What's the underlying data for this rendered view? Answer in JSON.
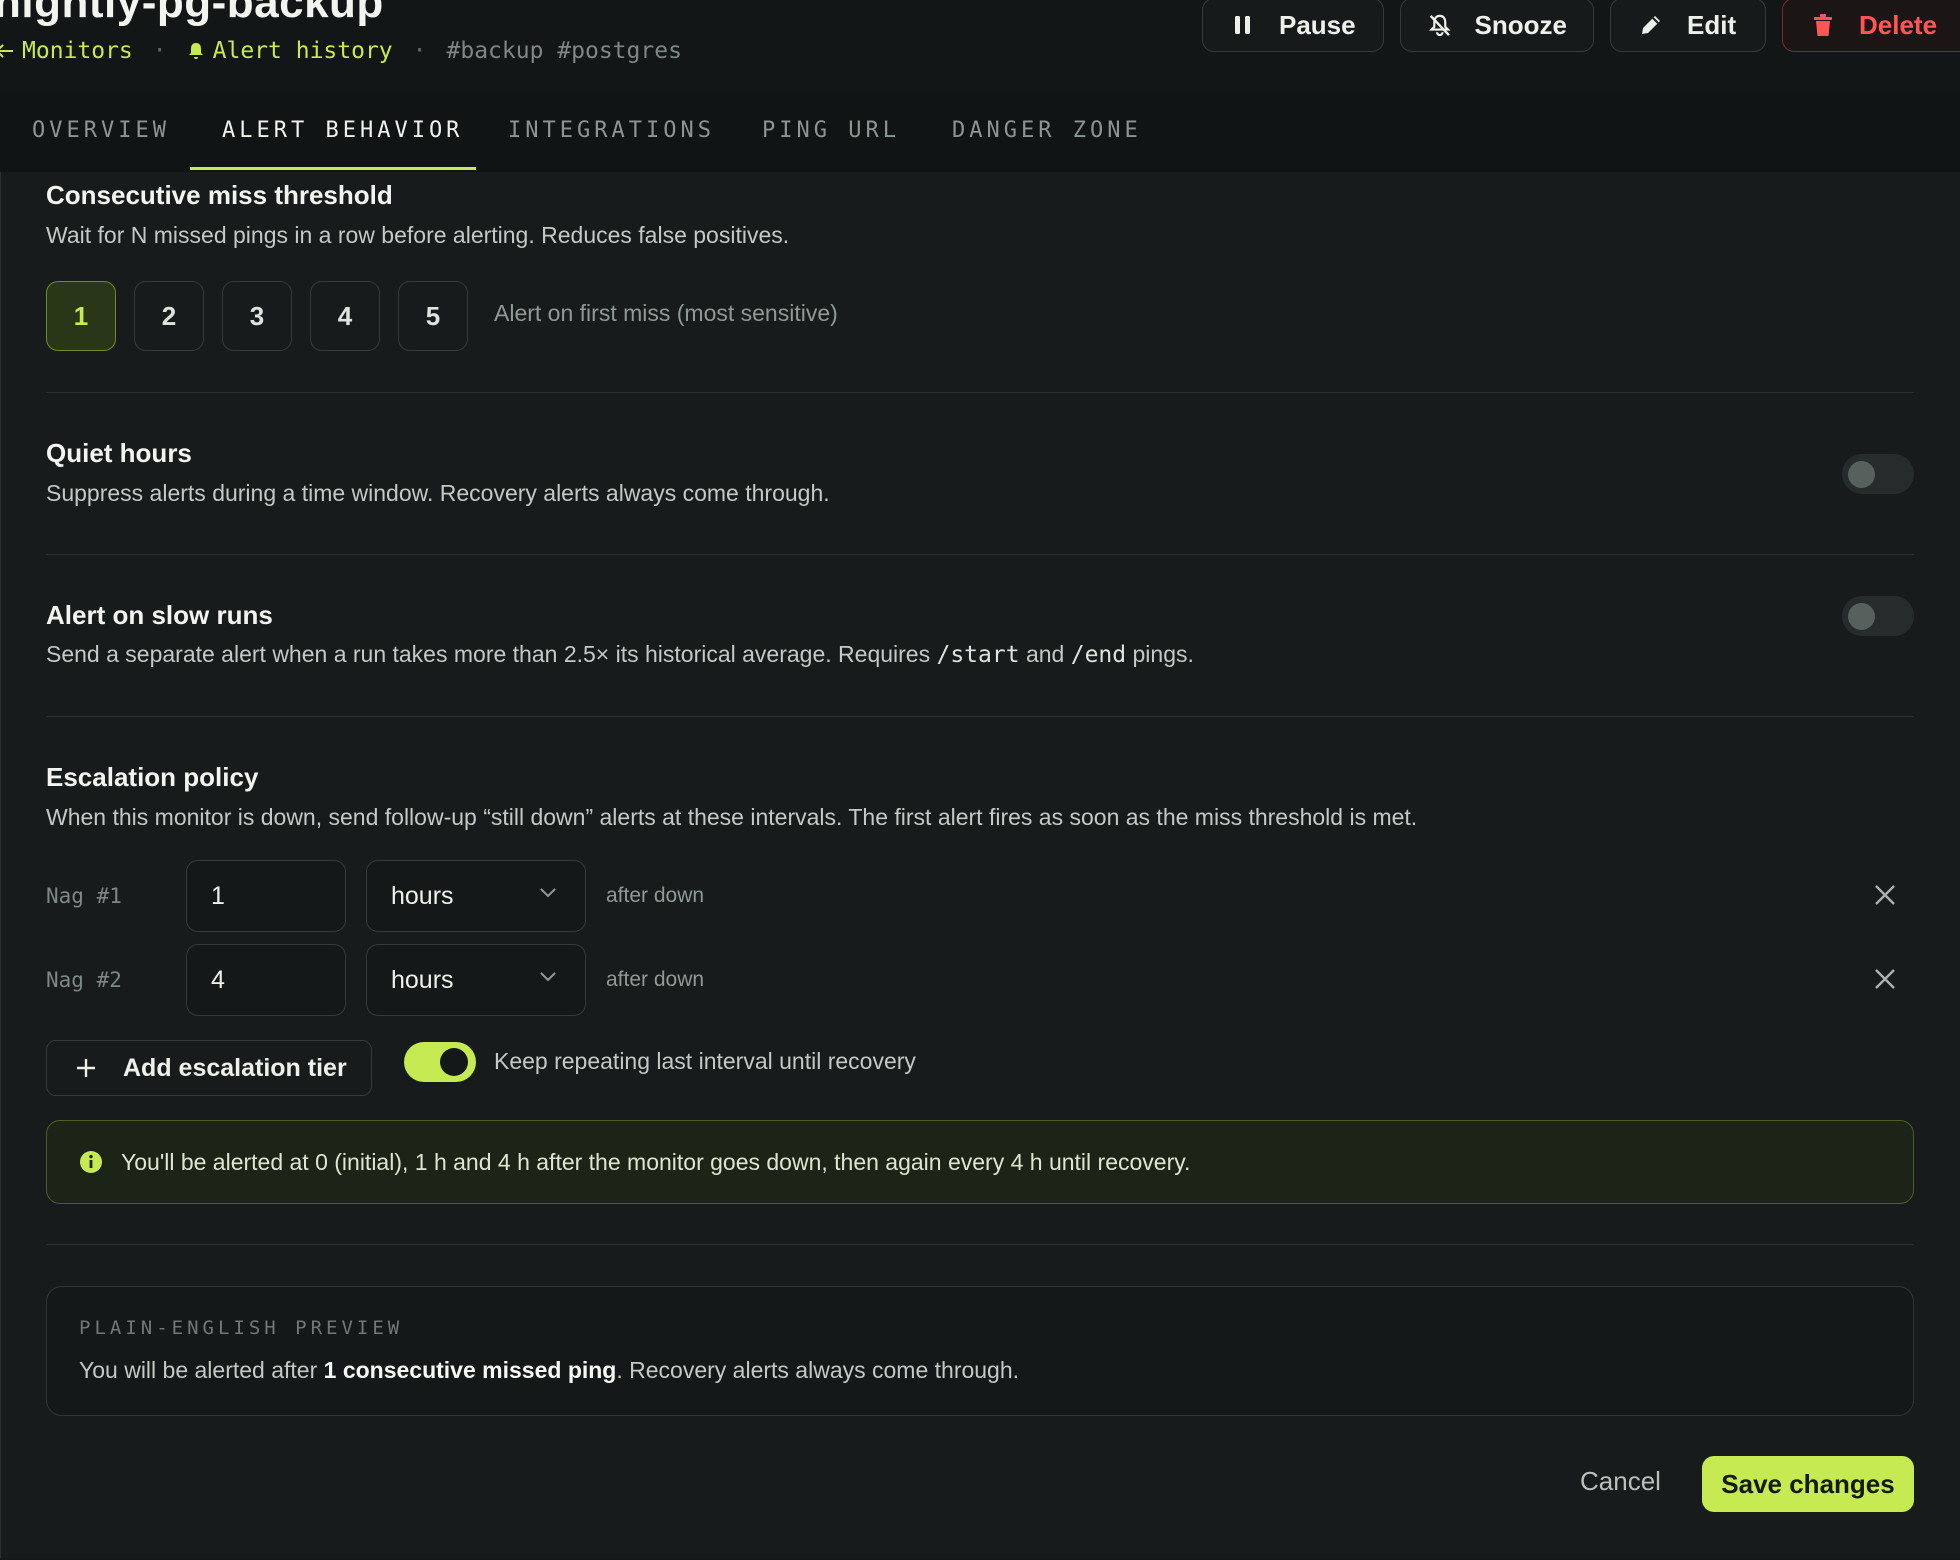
{
  "header": {
    "title": "nightly-pg-backup",
    "breadcrumb": {
      "monitors": "Monitors",
      "alert_history": "Alert history",
      "tags": "#backup #postgres"
    },
    "buttons": {
      "pause": "Pause",
      "snooze": "Snooze",
      "edit": "Edit",
      "delete": "Delete"
    }
  },
  "tabs": [
    {
      "label": "OVERVIEW",
      "active": false
    },
    {
      "label": "ALERT BEHAVIOR",
      "active": true
    },
    {
      "label": "INTEGRATIONS",
      "active": false
    },
    {
      "label": "PING URL",
      "active": false
    },
    {
      "label": "DANGER ZONE",
      "active": false
    }
  ],
  "threshold": {
    "title": "Consecutive miss threshold",
    "description": "Wait for N missed pings in a row before alerting. Reduces false positives.",
    "options": [
      "1",
      "2",
      "3",
      "4",
      "5"
    ],
    "selected": "1",
    "note": "Alert on first miss (most sensitive)"
  },
  "quiet_hours": {
    "title": "Quiet hours",
    "description": "Suppress alerts during a time window. Recovery alerts always come through.",
    "enabled": false
  },
  "slow_runs": {
    "title": "Alert on slow runs",
    "description_pre": "Send a separate alert when a run takes more than 2.5× its historical average. Requires ",
    "code_start": "/start",
    "description_mid": " and ",
    "code_end": "/end",
    "description_post": " pings.",
    "enabled": false
  },
  "escalation": {
    "title": "Escalation policy",
    "description": "When this monitor is down, send follow-up “still down” alerts at these intervals. The first alert fires as soon as the miss threshold is met.",
    "tiers": [
      {
        "label": "Nag #1",
        "value": "1",
        "unit": "hours",
        "suffix": "after down"
      },
      {
        "label": "Nag #2",
        "value": "4",
        "unit": "hours",
        "suffix": "after down"
      }
    ],
    "add_label": "Add escalation tier",
    "repeat_label": "Keep repeating last interval until recovery",
    "repeat_enabled": true,
    "info": "You'll be alerted at 0 (initial), 1 h and 4 h after the monitor goes down, then again every 4 h until recovery."
  },
  "preview": {
    "caption": "PLAIN-ENGLISH PREVIEW",
    "text_pre": "You will be alerted after ",
    "text_bold": "1 consecutive missed ping",
    "text_post": ". Recovery alerts always come through."
  },
  "footer": {
    "cancel": "Cancel",
    "save": "Save changes"
  },
  "colors": {
    "accent": "#c6ea52",
    "danger": "#ff5555",
    "background": "#171b1b"
  }
}
